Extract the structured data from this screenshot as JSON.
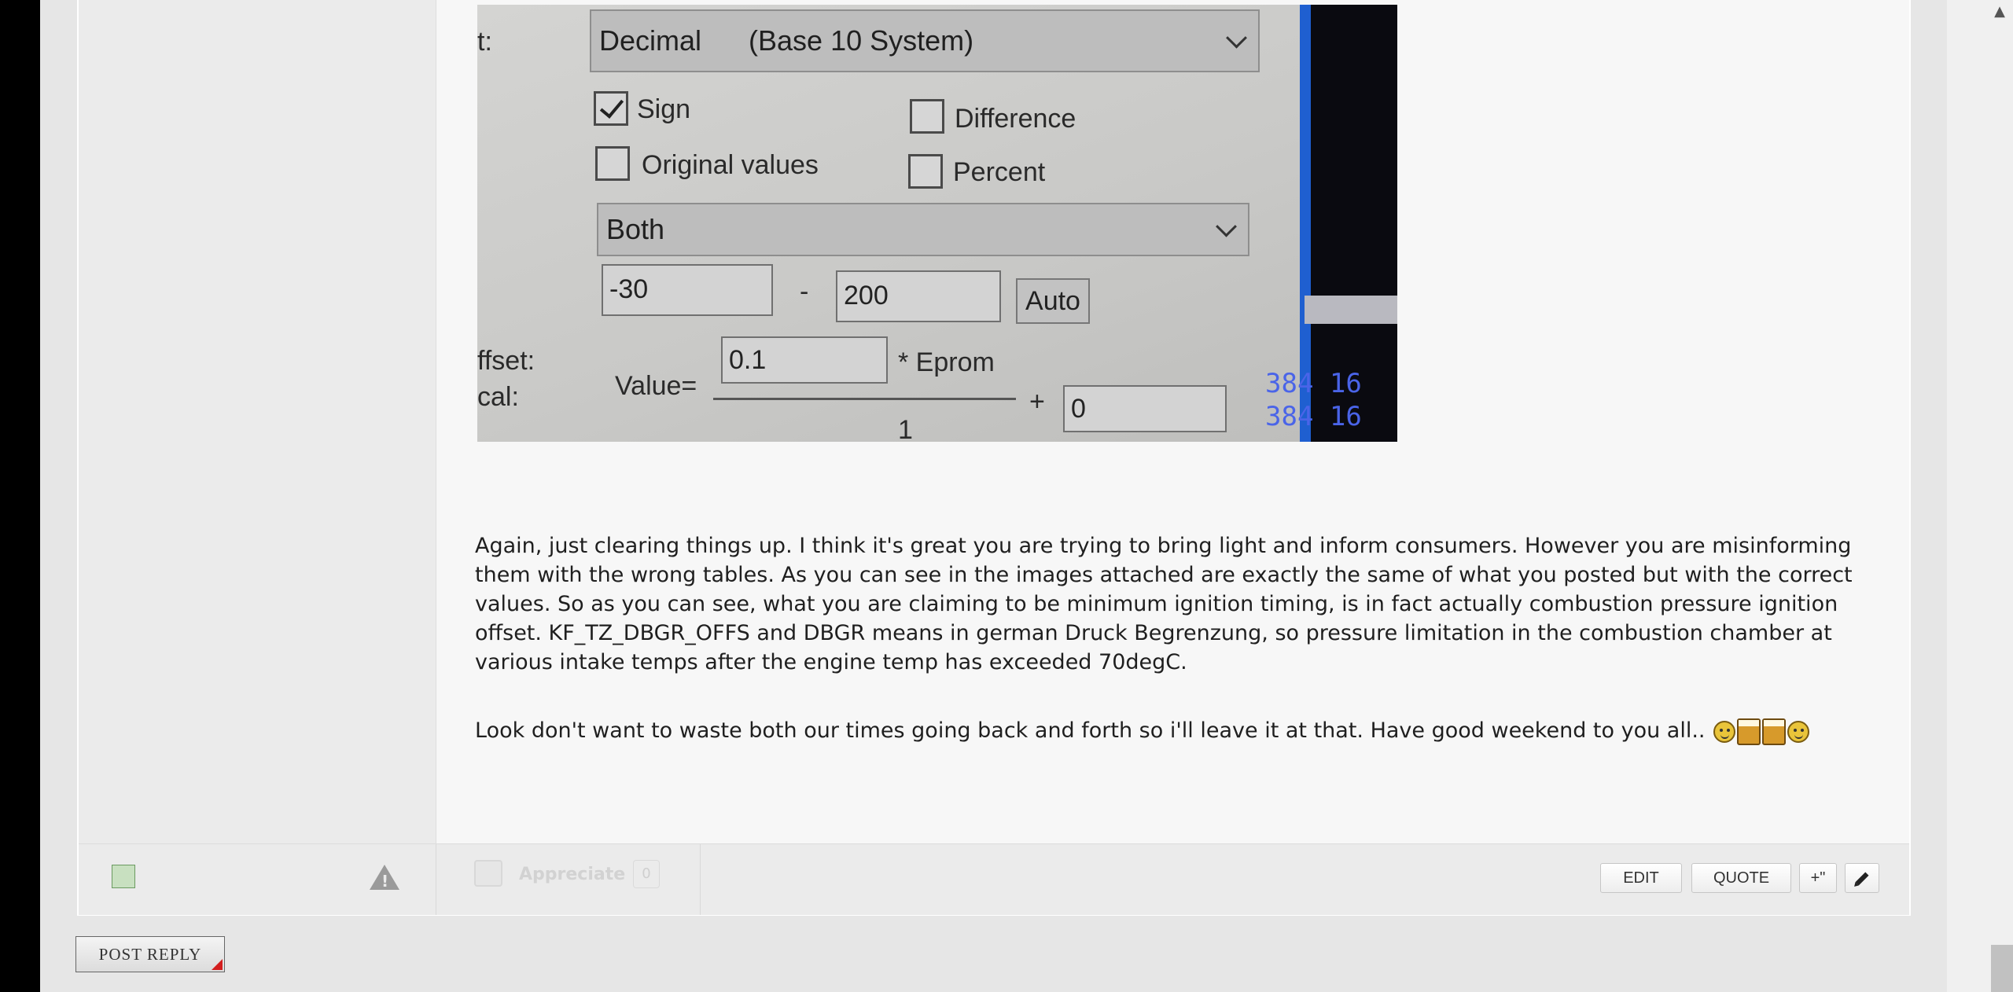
{
  "attachment": {
    "left_labels": [
      "t:",
      "ffset:",
      "cal:"
    ],
    "format_select": {
      "value": "Decimal",
      "description": "(Base 10 System)"
    },
    "checkboxes": [
      {
        "label": "Sign",
        "checked": true
      },
      {
        "label": "Difference",
        "checked": false
      },
      {
        "label": "Original values",
        "checked": false
      },
      {
        "label": "Percent",
        "checked": false
      }
    ],
    "mode_select": "Both",
    "range": {
      "min": "-30",
      "dash": "-",
      "max": "200",
      "auto_label": "Auto"
    },
    "formula": {
      "value_label": "Value=",
      "factor": "0.1",
      "eprom_label": "* Eprom",
      "plus": "+",
      "offset": "0",
      "divisor": "1"
    },
    "hex_lines": [
      "384 16",
      "384 16"
    ]
  },
  "message": {
    "paragraph1": "Again, just clearing things up. I think it's great you are trying to bring light and inform consumers. However you are misinforming them with the wrong tables. As you can see in the images attached are exactly the same of what you posted but with the correct values. So as you can see, what you are claiming to be minimum ignition timing, is in fact actually combustion pressure ignition offset. KF_TZ_DBGR_OFFS and DBGR means in german Druck Begrenzung, so pressure limitation in the combustion chamber at various intake temps after the engine temp has exceeded 70degC.",
    "paragraph2": "Look don't want to waste both our times going back and forth so i'll leave it at that. Have good weekend to you all.."
  },
  "footer": {
    "appreciate_label": "Appreciate",
    "appreciate_count": "0",
    "edit_label": "EDIT",
    "quote_label": "QUOTE",
    "multiquote_label": "+\""
  },
  "post_reply_label": "POST REPLY",
  "icons": [
    "warning-icon",
    "pencil-icon",
    "thumbs-icon",
    "smiley-icon",
    "beer-icon",
    "scroll-up-icon"
  ]
}
